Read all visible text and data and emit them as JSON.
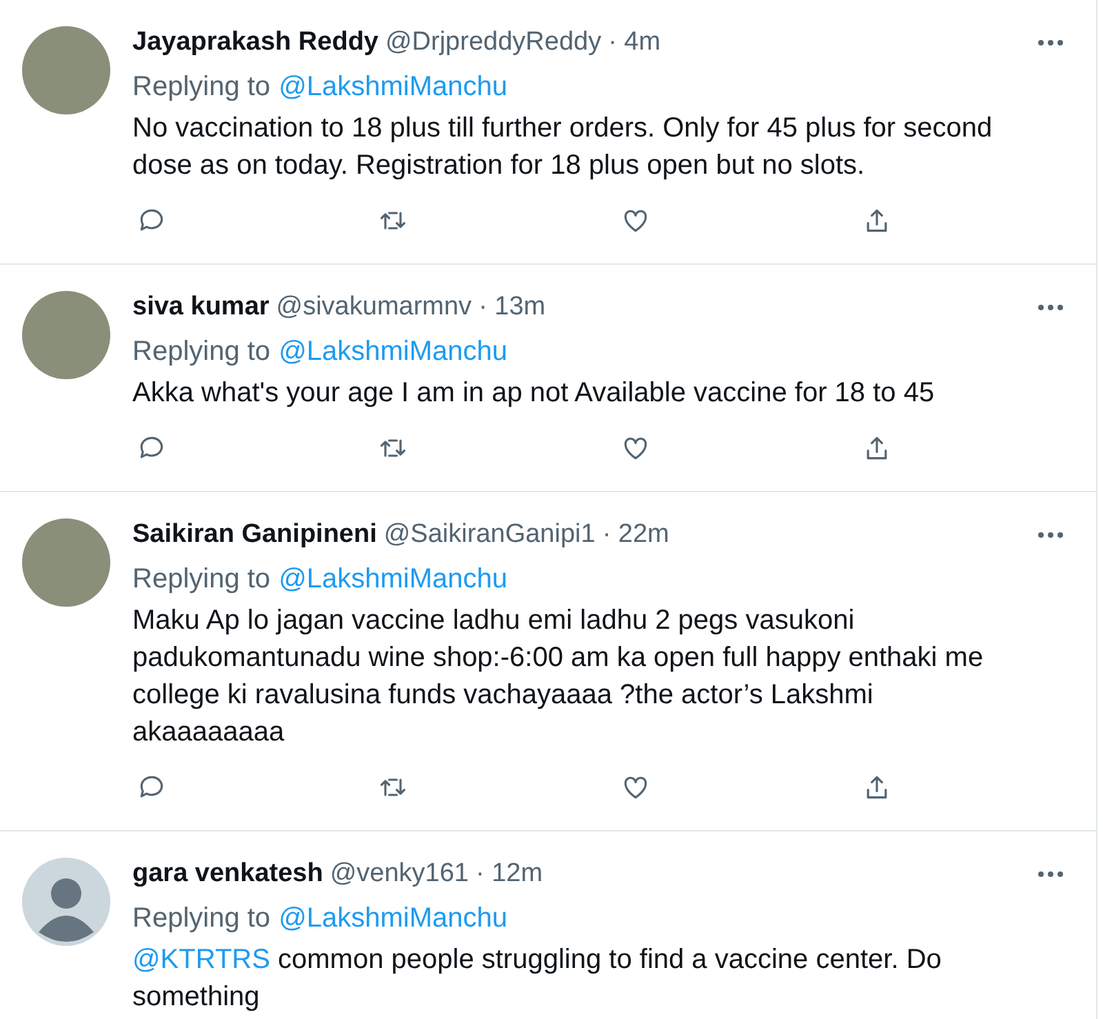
{
  "tweets": [
    {
      "avatar": {
        "kind": "photo"
      },
      "name": "Jayaprakash Reddy",
      "handle": "@DrjpreddyReddy",
      "time": "· 4m",
      "replying_label": "Replying to",
      "replying_to": "@LakshmiManchu",
      "body": [
        {
          "kind": "text",
          "text": "No vaccination to  18 plus till further orders. Only for 45 plus for second dose as on today. Registration for 18 plus open but no slots."
        }
      ],
      "actions": true
    },
    {
      "avatar": {
        "kind": "photo"
      },
      "name": "siva kumar",
      "handle": "@sivakumarmnv",
      "time": "· 13m",
      "replying_label": "Replying to",
      "replying_to": "@LakshmiManchu",
      "body": [
        {
          "kind": "text",
          "text": "Akka what's your age I am in ap not Available vaccine for 18 to 45"
        }
      ],
      "actions": true
    },
    {
      "avatar": {
        "kind": "photo"
      },
      "name": "Saikiran Ganipineni",
      "handle": "@SaikiranGanipi1",
      "time": "· 22m",
      "replying_label": "Replying to",
      "replying_to": "@LakshmiManchu",
      "body": [
        {
          "kind": "text",
          "text": "Maku Ap lo jagan vaccine ladhu emi ladhu 2 pegs vasukoni padukomantunadu wine shop:-6:00 am ka open full happy enthaki me college ki ravalusina funds vachayaaaa ?the actor’s  Lakshmi akaaaaaaaa"
        }
      ],
      "actions": true
    },
    {
      "avatar": {
        "kind": "default"
      },
      "name": "gara venkatesh",
      "handle": "@venky161",
      "time": "· 12m",
      "replying_label": "Replying to",
      "replying_to": "@LakshmiManchu",
      "body": [
        {
          "kind": "mention",
          "text": "@KTRTRS"
        },
        {
          "kind": "text",
          "text": " common people struggling to find a vaccine center. Do something"
        }
      ],
      "actions": false
    }
  ]
}
